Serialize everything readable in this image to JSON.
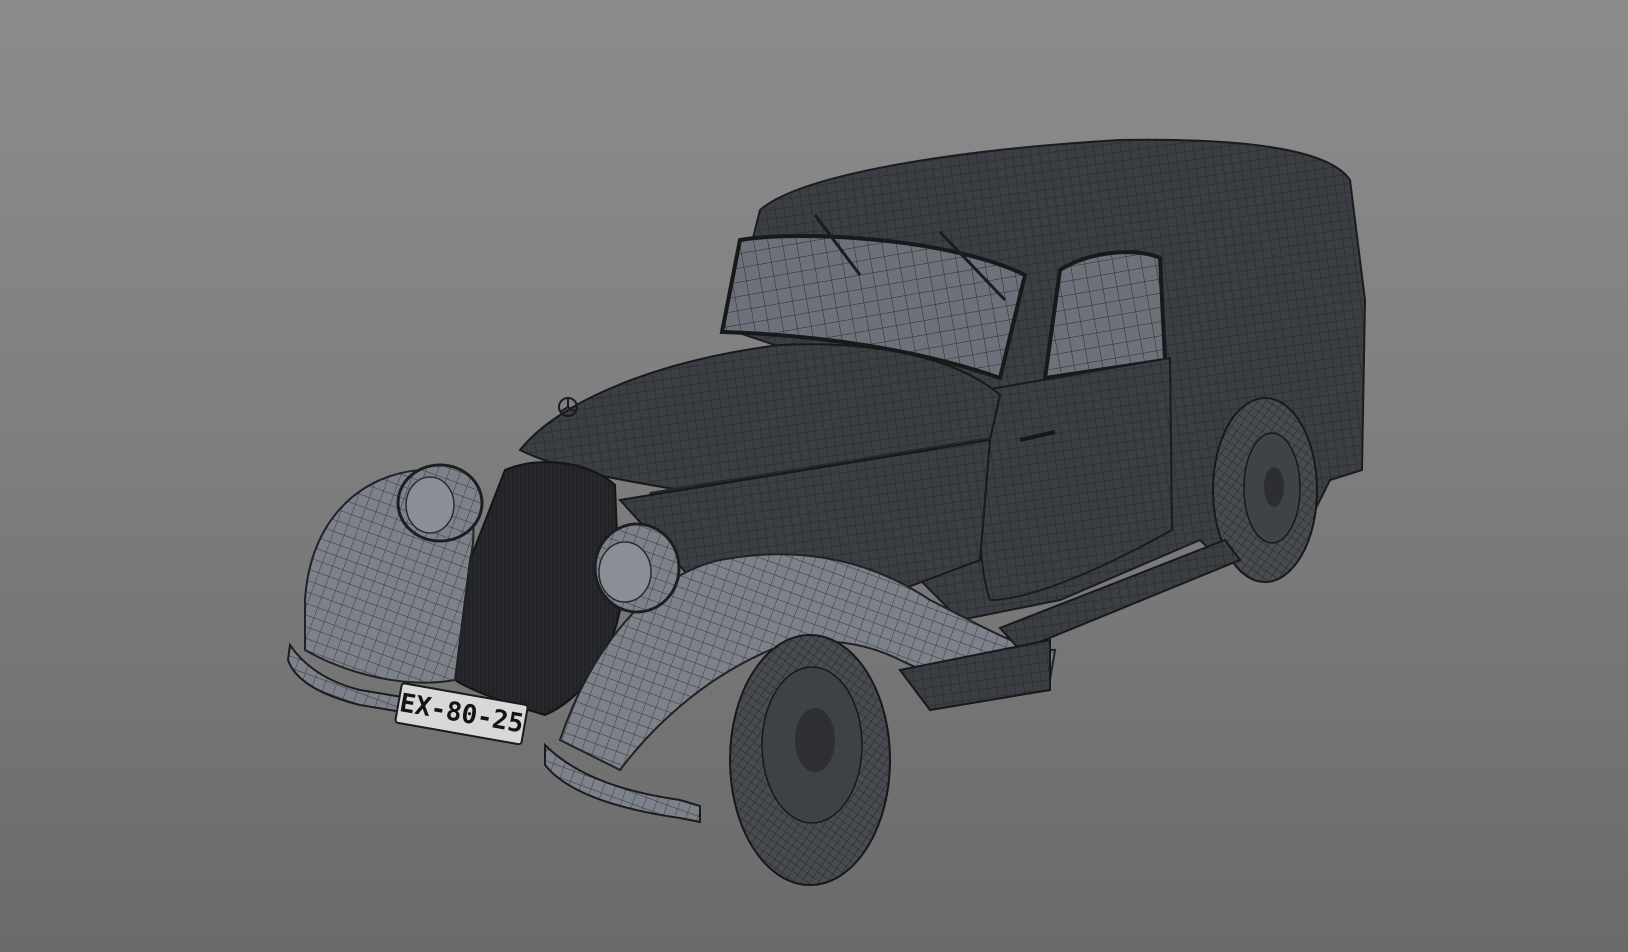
{
  "viewport": {
    "background_top": "#8c8c8c",
    "background_bottom": "#6a6a6a"
  },
  "model": {
    "mesh_color": "#3a3d42",
    "wire_color": "#1c1d20",
    "glass_color": "#6e737b",
    "license_plate": "EX-80-25",
    "hood_emblem": "three-pointed-star-icon"
  }
}
